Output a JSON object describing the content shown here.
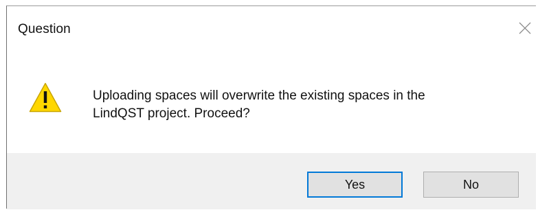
{
  "dialog": {
    "title": "Question",
    "message_line1": "Uploading spaces will overwrite the existing spaces in the",
    "message_line2": "LindQST project. Proceed?",
    "icon": "warning-icon",
    "buttons": {
      "yes_label": "Yes",
      "no_label": "No"
    },
    "colors": {
      "accent": "#0078d7",
      "warning_fill": "#ffd700",
      "footer_bg": "#f0f0f0"
    }
  }
}
